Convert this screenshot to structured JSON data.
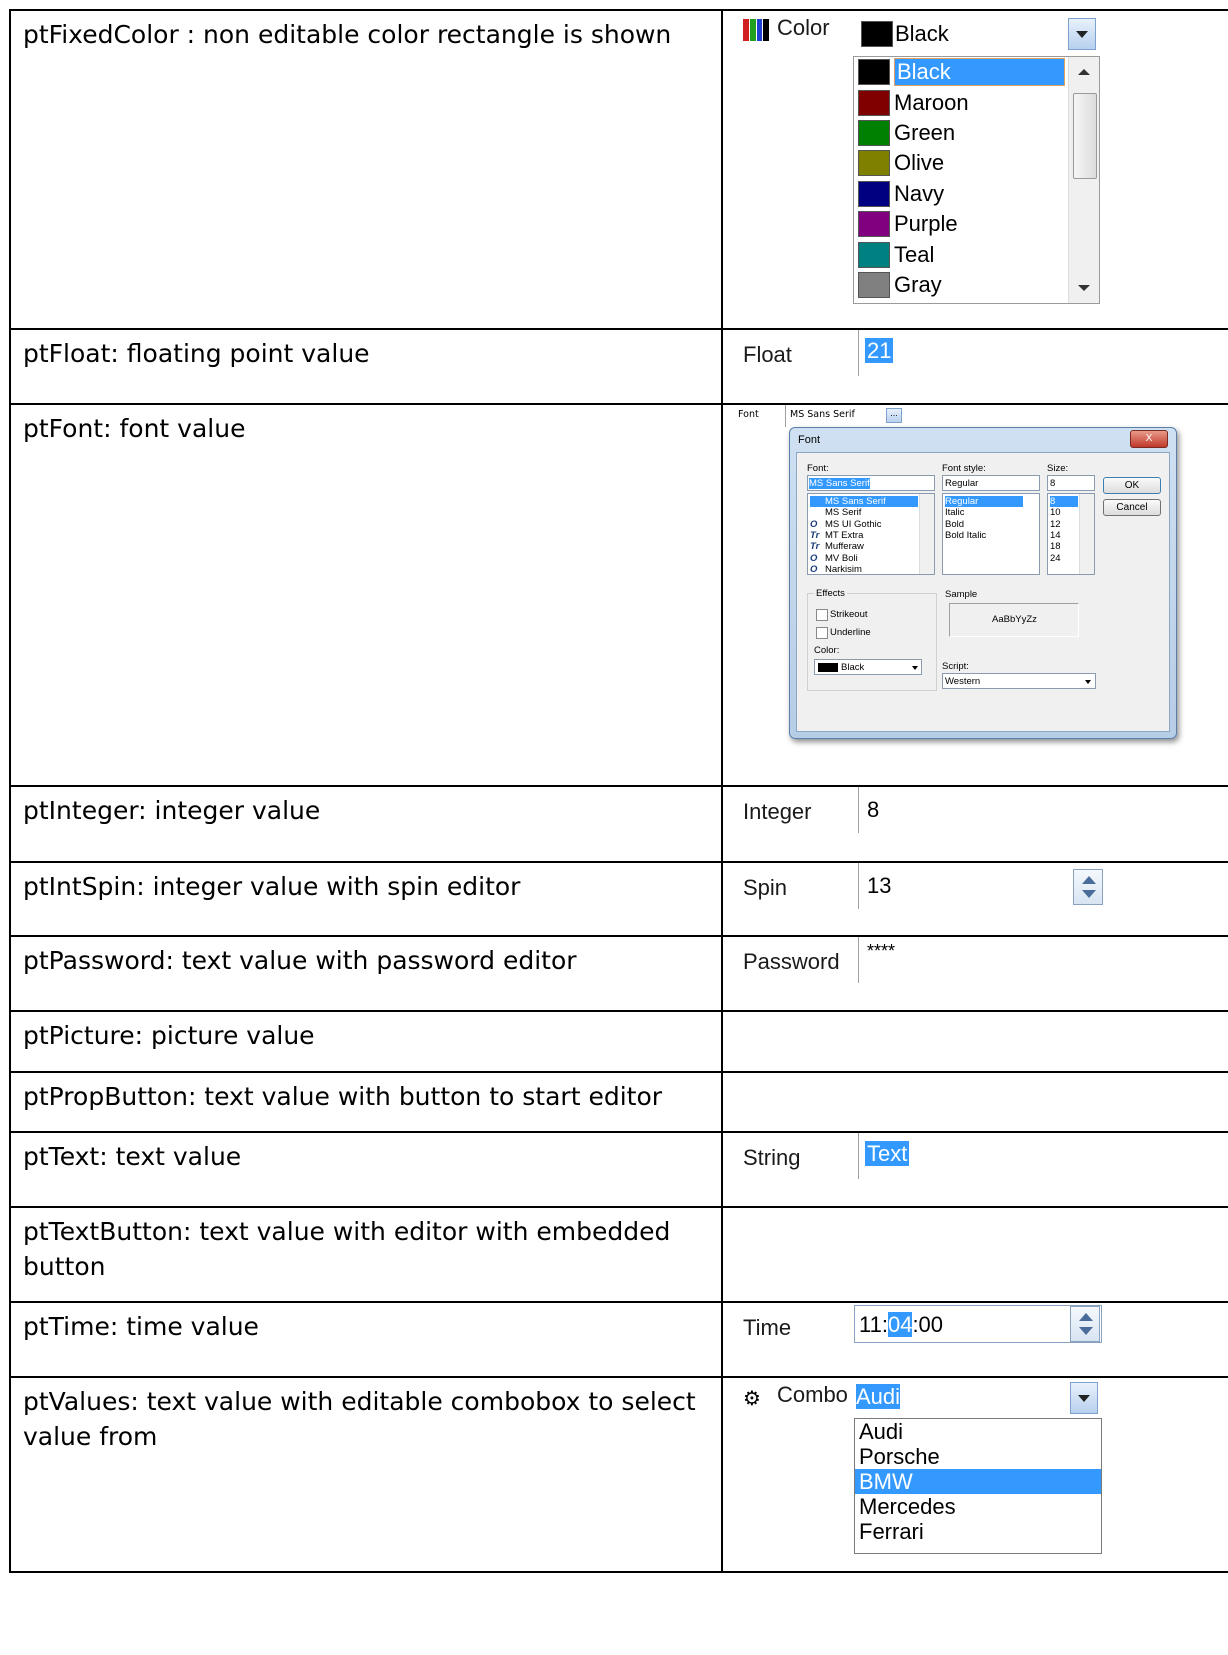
{
  "rows": [
    {
      "desc": "ptFixedColor : non editable color rectangle is shown",
      "label": "Color",
      "value": "Black"
    },
    {
      "desc": "ptFloat: floating point value",
      "label": "Float",
      "value": "21"
    },
    {
      "desc": "ptFont: font value",
      "label": "Font",
      "value": "MS Sans Serif"
    },
    {
      "desc": "ptInteger: integer value",
      "label": "Integer",
      "value": "8"
    },
    {
      "desc": "ptIntSpin: integer value with spin editor",
      "label": "Spin",
      "value": "13"
    },
    {
      "desc": "ptPassword: text value with password editor",
      "label": "Password",
      "value": "****"
    },
    {
      "desc": "ptPicture: picture value"
    },
    {
      "desc": "ptPropButton: text value with button to start editor"
    },
    {
      "desc": "ptText: text value",
      "label": "String",
      "value": "Text"
    },
    {
      "desc": "ptTextButton: text value with editor with embedded button"
    },
    {
      "desc": "ptTime: time value",
      "label": "Time",
      "value_pre": "11:",
      "value_sel": "04",
      "value_post": ":00"
    },
    {
      "desc": "ptValues: text value with editable combobox to select value from",
      "label": "Combo",
      "value": "Audi"
    }
  ],
  "color_list": [
    {
      "name": "Black",
      "color": "#000000"
    },
    {
      "name": "Maroon",
      "color": "#800000"
    },
    {
      "name": "Green",
      "color": "#008000"
    },
    {
      "name": "Olive",
      "color": "#808000"
    },
    {
      "name": "Navy",
      "color": "#000080"
    },
    {
      "name": "Purple",
      "color": "#800080"
    },
    {
      "name": "Teal",
      "color": "#008080"
    },
    {
      "name": "Gray",
      "color": "#808080"
    }
  ],
  "font_dialog": {
    "title": "Font",
    "close": "X",
    "font_label": "Font:",
    "font_value": "MS Sans Serif",
    "fonts": [
      "MS Sans Serif",
      "MS Serif",
      "MS UI Gothic",
      "MT Extra",
      "Mufferaw",
      "MV Boli",
      "Narkisim"
    ],
    "font_icons": [
      "",
      "",
      "O",
      "Tr",
      "Tr",
      "O",
      "O"
    ],
    "style_label": "Font style:",
    "style_value": "Regular",
    "styles": [
      "Regular",
      "Italic",
      "Bold",
      "Bold Italic"
    ],
    "size_label": "Size:",
    "size_value": "8",
    "sizes": [
      "8",
      "10",
      "12",
      "14",
      "18",
      "24"
    ],
    "ok": "OK",
    "cancel": "Cancel",
    "effects_label": "Effects",
    "strikeout": "Strikeout",
    "underline": "Underline",
    "color_label": "Color:",
    "color_value": "Black",
    "sample_label": "Sample",
    "sample_text": "AaBbYyZz",
    "script_label": "Script:",
    "script_value": "Western"
  },
  "combo_list": [
    "Audi",
    "Porsche",
    "BMW",
    "Mercedes",
    "Ferrari"
  ],
  "colors": {
    "selection": "#3399ff"
  }
}
